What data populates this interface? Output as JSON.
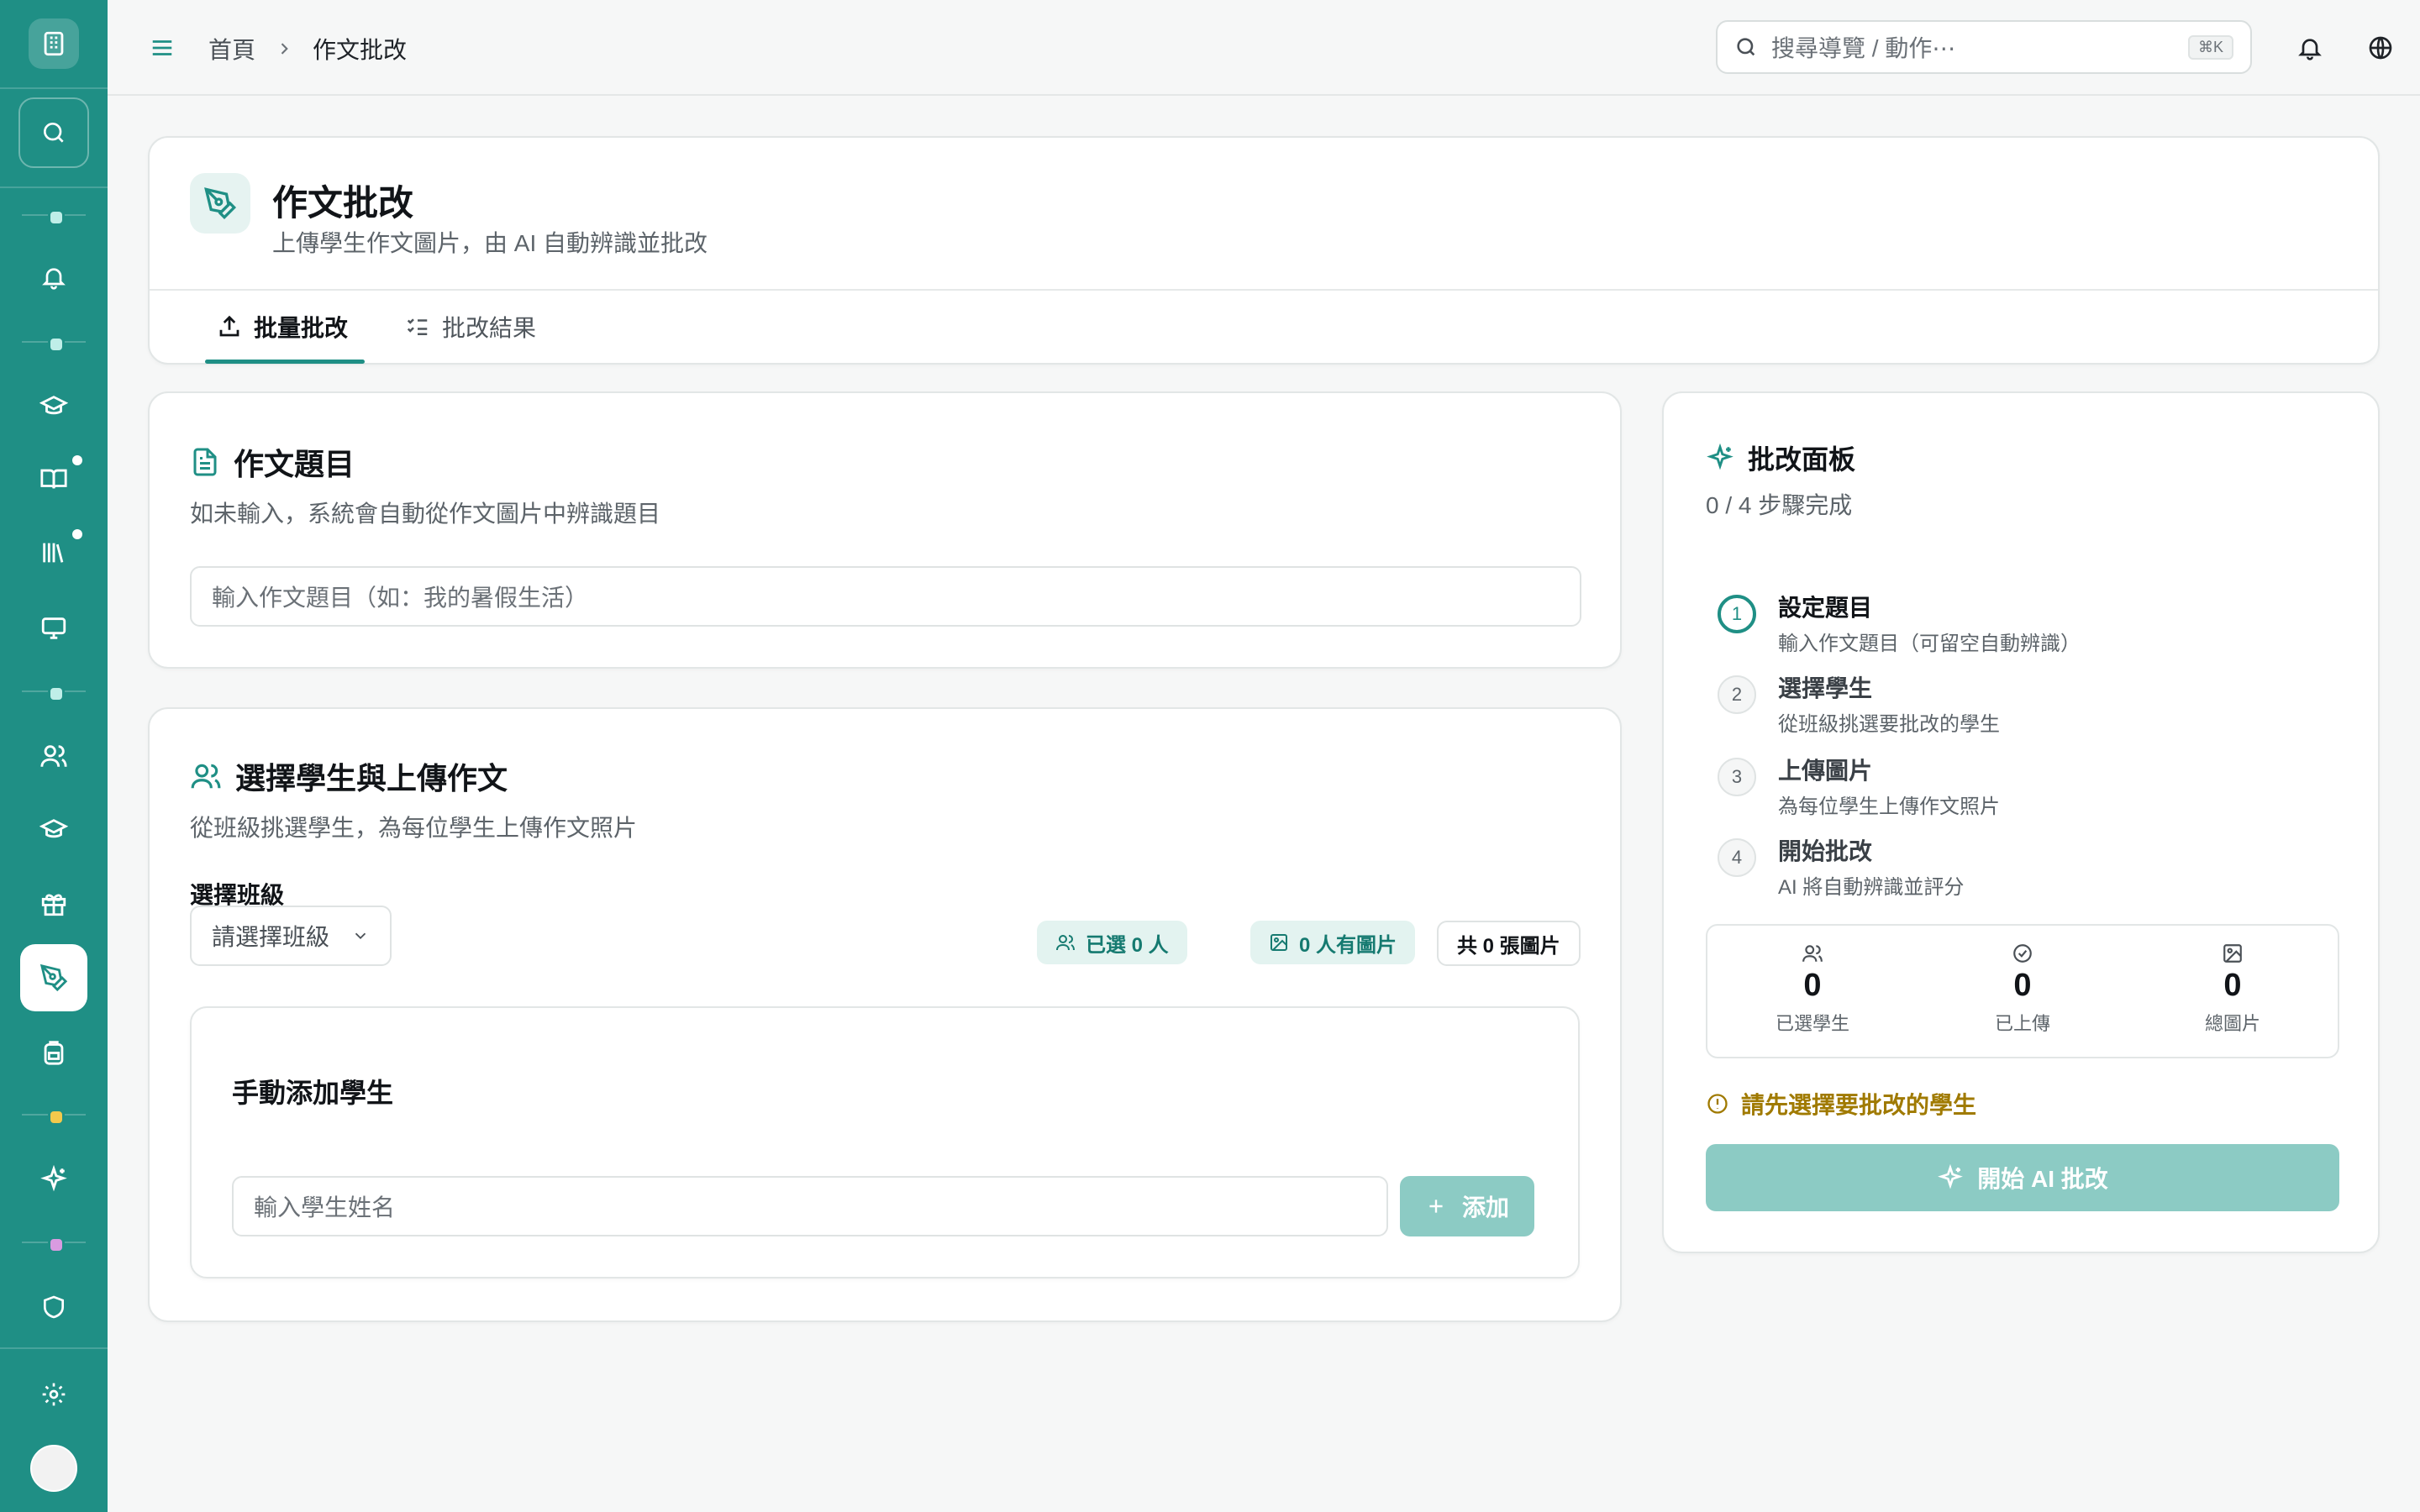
{
  "sidebar": {
    "items": [
      {
        "name": "notifications",
        "icon": "bell-icon"
      },
      {
        "name": "courses",
        "icon": "graduation-cap-icon"
      },
      {
        "name": "books",
        "icon": "book-open-icon"
      },
      {
        "name": "library",
        "icon": "library-icon"
      },
      {
        "name": "presentations",
        "icon": "monitor-icon"
      },
      {
        "name": "users",
        "icon": "users-icon"
      },
      {
        "name": "classes",
        "icon": "graduation-cap-icon"
      },
      {
        "name": "rewards",
        "icon": "gift-icon"
      },
      {
        "name": "essay-grading",
        "icon": "pen-tool-icon",
        "active": true
      },
      {
        "name": "backpack",
        "icon": "backpack-icon"
      },
      {
        "name": "ai-tools",
        "icon": "sparkles-icon"
      },
      {
        "name": "security",
        "icon": "shield-icon"
      },
      {
        "name": "settings",
        "icon": "gear-icon"
      }
    ]
  },
  "topbar": {
    "breadcrumb": {
      "home": "首頁",
      "current": "作文批改"
    },
    "search_placeholder": "搜尋導覽 / 動作⋯",
    "shortcut": "⌘K"
  },
  "header": {
    "title": "作文批改",
    "subtitle": "上傳學生作文圖片，由 AI 自動辨識並批改",
    "tabs": [
      {
        "label": "批量批改",
        "active": true
      },
      {
        "label": "批改結果",
        "active": false
      }
    ]
  },
  "topic": {
    "title": "作文題目",
    "subtitle": "如未輸入，系統會自動從作文圖片中辨識題目",
    "placeholder": "輸入作文題目（如：我的暑假生活）"
  },
  "students": {
    "title": "選擇學生與上傳作文",
    "subtitle": "從班級挑選學生，為每位學生上傳作文照片",
    "class_label": "選擇班級",
    "class_select": "請選擇班級",
    "pills": {
      "selected": "已選 0 人",
      "with_images": "0 人有圖片",
      "total_images": "共 0 張圖片"
    },
    "manual": {
      "title": "手動添加學生",
      "placeholder": "輸入學生姓名",
      "add_label": "添加"
    }
  },
  "panel": {
    "title": "批改面板",
    "progress": "0 / 4 步驟完成",
    "steps": [
      {
        "num": "1",
        "title": "設定題目",
        "desc": "輸入作文題目（可留空自動辨識）",
        "active": true
      },
      {
        "num": "2",
        "title": "選擇學生",
        "desc": "從班級挑選要批改的學生",
        "active": false
      },
      {
        "num": "3",
        "title": "上傳圖片",
        "desc": "為每位學生上傳作文照片",
        "active": false
      },
      {
        "num": "4",
        "title": "開始批改",
        "desc": "AI 將自動辨識並評分",
        "active": false
      }
    ],
    "stats": [
      {
        "value": "0",
        "label": "已選學生"
      },
      {
        "value": "0",
        "label": "已上傳"
      },
      {
        "value": "0",
        "label": "總圖片"
      }
    ],
    "warning": "請先選擇要批改的學生",
    "start_label": "開始 AI 批改"
  },
  "colors": {
    "accent": "#1f8f85",
    "accent_light": "#e3f3f0",
    "disabled_button": "#8ccbc4",
    "warning": "#a07a00"
  }
}
